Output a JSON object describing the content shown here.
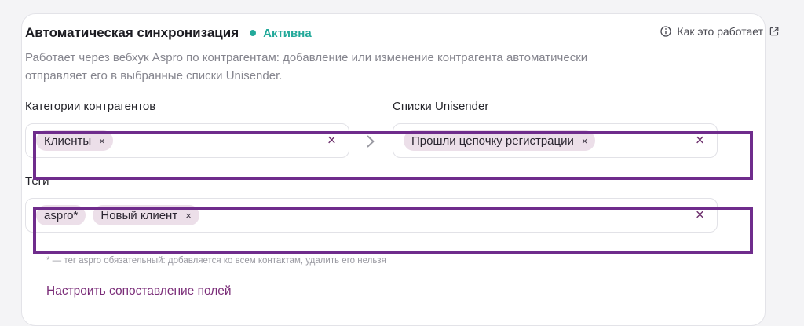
{
  "header": {
    "title": "Автоматическая синхронизация",
    "status_label": "Активна",
    "status_color": "#22a99a",
    "help_link": "Как это работает",
    "help_icon": "info-icon",
    "external_icon": "external-link-icon"
  },
  "description": "Работает через вебхук Aspro по контрагентам: добавление или изменение контрагента автоматически отправляет его в выбранные списки Unisender.",
  "categories": {
    "label": "Категории контрагентов",
    "chips": [
      {
        "label": "Клиенты",
        "remove": "×"
      }
    ],
    "clear": "×"
  },
  "arrow_icon": "chevron-right-icon",
  "lists": {
    "label": "Списки Unisender",
    "chips": [
      {
        "label": "Прошли цепочку регистрации",
        "remove": "×"
      }
    ],
    "clear": "×"
  },
  "tags": {
    "label": "Теги",
    "chips": [
      {
        "label": "aspro*"
      },
      {
        "label": "Новый клиент",
        "remove": "×"
      }
    ],
    "clear": "×"
  },
  "note": "* — тег aspro обязательный: добавляется ко всем контактам, удалить его нельзя",
  "config_link": "Настроить сопоставление полей",
  "colors": {
    "accent": "#7a2c78",
    "chip_bg": "#ecdfe9",
    "highlight_border": "#6f2c8c"
  }
}
